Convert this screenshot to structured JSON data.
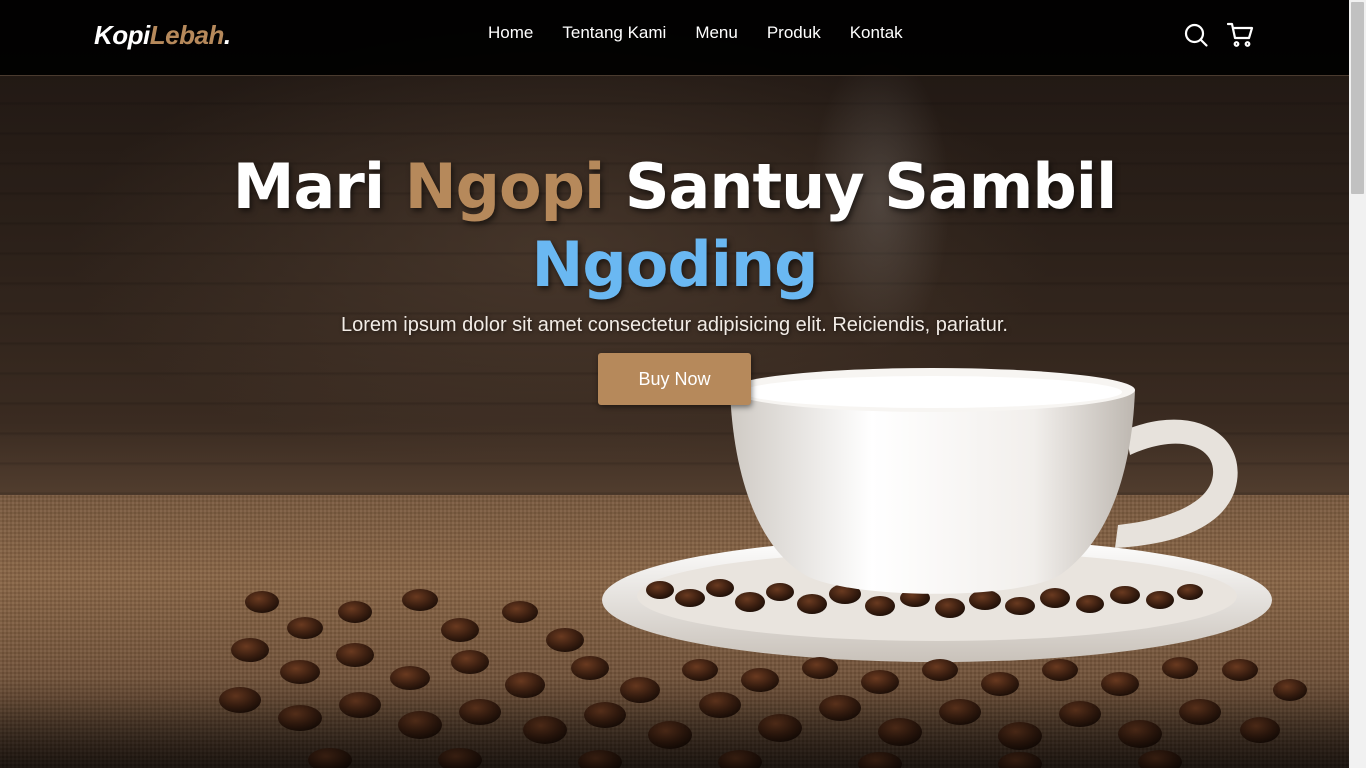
{
  "navbar": {
    "logo": {
      "part1": "Kopi",
      "part2": "Lebah",
      "part3": "."
    },
    "links": [
      "Home",
      "Tentang Kami",
      "Menu",
      "Produk",
      "Kontak"
    ],
    "icons": [
      "search-icon",
      "shopping-cart-icon"
    ]
  },
  "hero": {
    "headline": {
      "word1": "Mari",
      "word2": "Ngopi",
      "word3": "Santuy Sambil",
      "word4": "Ngoding"
    },
    "subtitle": "Lorem ipsum dolor sit amet consectetur adipisicing elit. Reiciendis, pariatur.",
    "button_label": "Buy Now",
    "image": "coffee-cup-with-beans"
  },
  "colors": {
    "accent": "#b6895b",
    "highlight": "#6ab8f2",
    "navbar_bg": "#000000",
    "text": "#ffffff"
  }
}
